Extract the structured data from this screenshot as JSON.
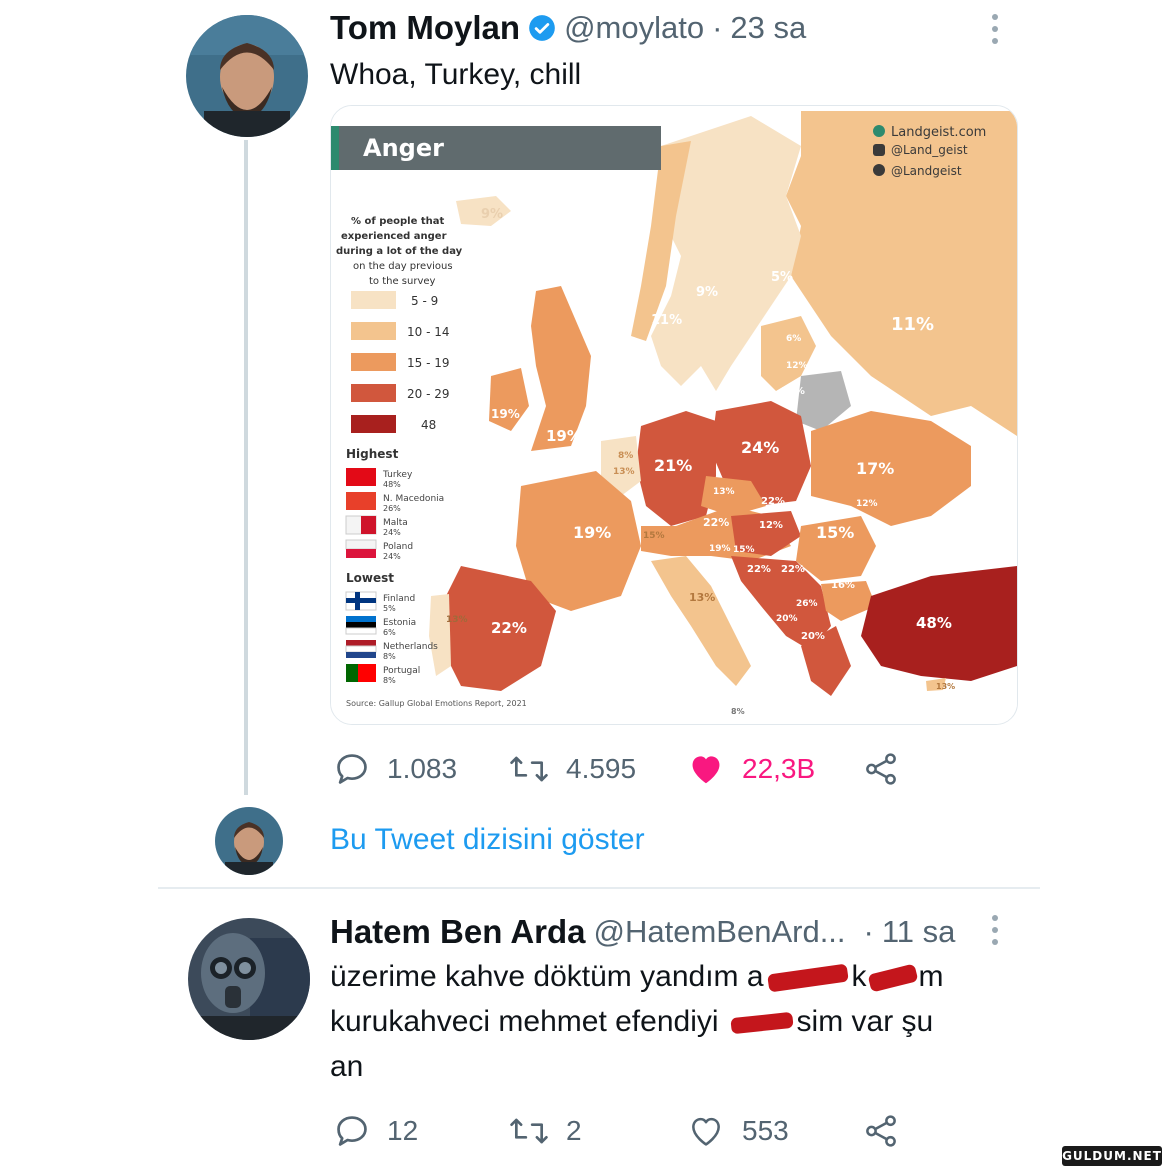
{
  "tweet": {
    "author_name": "Tom Moylan",
    "handle": "@moylato",
    "separator": "·",
    "time": "23 sa",
    "text": "Whoa, Turkey, chill",
    "stats": {
      "replies": "1.083",
      "retweets": "4.595",
      "likes": "22,3B"
    },
    "like_color": "#f91880"
  },
  "map": {
    "title": "Anger",
    "credits": [
      "Landgeist.com",
      "@Land_geist",
      "@Landgeist"
    ],
    "legend_title_lines": [
      "% of people that",
      "experienced anger",
      "during a lot of the day",
      "on the day previous",
      "to the survey"
    ],
    "legend": [
      {
        "range": "5 - 9",
        "color": "#f7e2c4"
      },
      {
        "range": "10 - 14",
        "color": "#f3c48e"
      },
      {
        "range": "15 - 19",
        "color": "#ec9a5e"
      },
      {
        "range": "20 - 29",
        "color": "#d1573d"
      },
      {
        "range": "48",
        "color": "#a8201e"
      }
    ],
    "highest_label": "Highest",
    "highest": [
      {
        "country": "Turkey",
        "value": "48%"
      },
      {
        "country": "N. Macedonia",
        "value": "26%"
      },
      {
        "country": "Malta",
        "value": "24%"
      },
      {
        "country": "Poland",
        "value": "24%"
      }
    ],
    "lowest_label": "Lowest",
    "lowest": [
      {
        "country": "Finland",
        "value": "5%"
      },
      {
        "country": "Estonia",
        "value": "6%"
      },
      {
        "country": "Netherlands",
        "value": "8%"
      },
      {
        "country": "Portugal",
        "value": "8%"
      }
    ],
    "source": "Source: Gallup Global Emotions Report, 2021",
    "labels": [
      "9%",
      "9%",
      "5%",
      "11%",
      "11%",
      "6%",
      "12%",
      "13%",
      "12%",
      "19%",
      "19%",
      "8%",
      "13%",
      "21%",
      "24%",
      "17%",
      "19%",
      "15%",
      "13%",
      "15%",
      "22%",
      "12%",
      "22%",
      "19%",
      "22%",
      "12%",
      "15%",
      "13%",
      "13%",
      "22%",
      "22%",
      "16%",
      "26%",
      "20%",
      "20%",
      "48%",
      "13%",
      "8%",
      "22%",
      "24%"
    ]
  },
  "thread_link": "Bu Tweet dizisini göster",
  "reply": {
    "author_name": "Hatem Ben Arda",
    "handle": "@HatemBenArd...",
    "separator": "·",
    "time": "11 sa",
    "lines": [
      "üzerime kahve döktüm yandım a",
      "k",
      "m",
      "kurukahveci mehmet efendiyi",
      "sim var şu",
      "an"
    ],
    "stats": {
      "replies": "12",
      "retweets": "2",
      "likes": "553"
    },
    "redaction_color": "#c4161c"
  },
  "watermark": "GULDUM.NET",
  "link_color": "#1d9bf0",
  "verified_color": "#1d9bf0"
}
